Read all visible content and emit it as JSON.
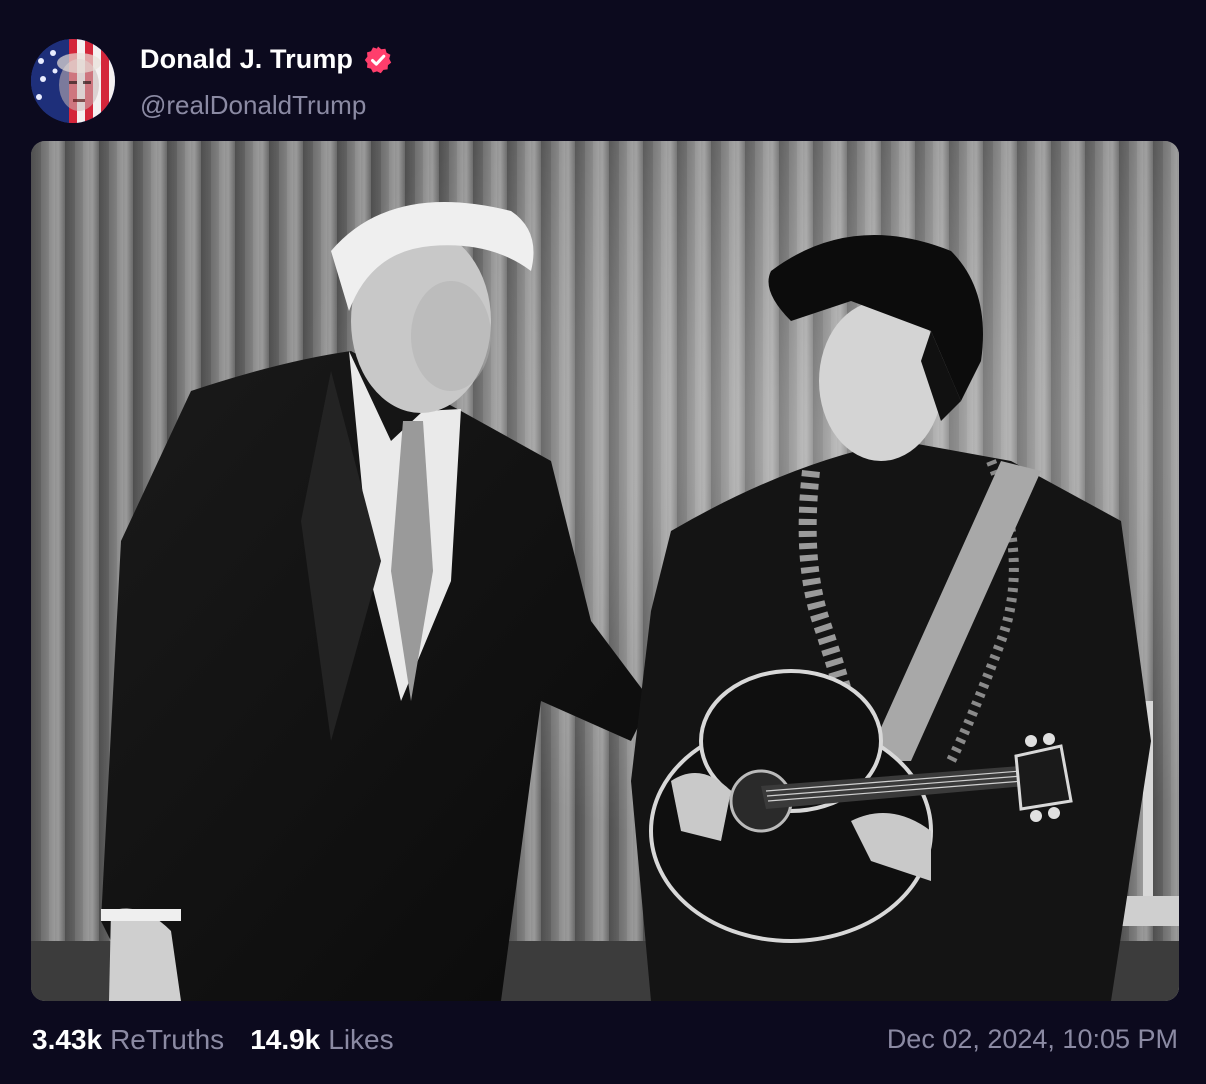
{
  "author": {
    "display_name": "Donald J. Trump",
    "handle": "@realDonaldTrump",
    "verified": true,
    "verified_color": "#ff3e6c"
  },
  "media": {
    "type": "image",
    "style": "black-and-white photograph",
    "avatar_icon": "flag-portrait-avatar"
  },
  "stats": {
    "retruths_count": "3.43k",
    "retruths_label": "ReTruths",
    "likes_count": "14.9k",
    "likes_label": "Likes"
  },
  "timestamp": "Dec 02, 2024, 10:05 PM",
  "colors": {
    "background": "#0c0a1e",
    "primary_text": "#ffffff",
    "secondary_text": "#8b8aa3"
  }
}
